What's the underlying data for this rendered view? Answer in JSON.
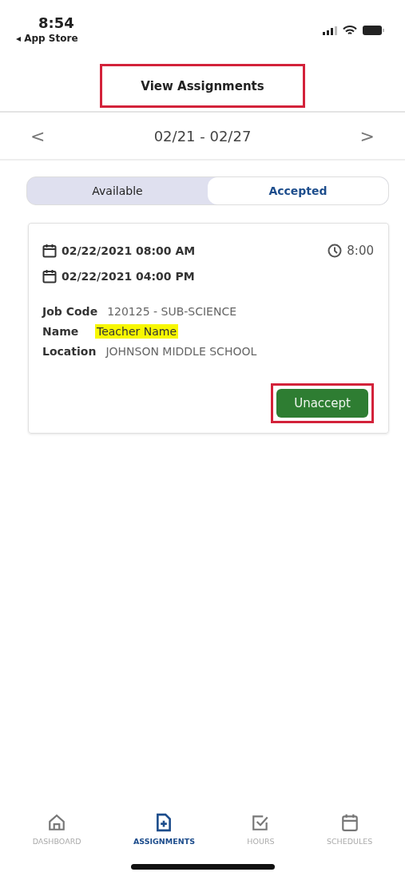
{
  "status_bar": {
    "time": "8:54",
    "back_label": "◂ App Store"
  },
  "header": {
    "title": "View Assignments",
    "annotated": true
  },
  "week_nav": {
    "prev": "<",
    "range": "02/21 - 02/27",
    "next": ">"
  },
  "tabs": [
    {
      "label": "Available",
      "selected": false
    },
    {
      "label": "Accepted",
      "selected": true
    }
  ],
  "assignment": {
    "start": "02/22/2021 08:00 AM",
    "end": "02/22/2021 04:00 PM",
    "duration": "8:00",
    "fields": [
      {
        "label": "Job Code",
        "value": "120125 - SUB-SCIENCE",
        "highlighted": false
      },
      {
        "label": "Name",
        "value": "Teacher Name",
        "highlighted": true
      },
      {
        "label": "Location",
        "value": "JOHNSON MIDDLE SCHOOL",
        "highlighted": false
      }
    ],
    "action": {
      "label": "Unaccept",
      "annotated": true
    }
  },
  "bottom_nav": [
    {
      "kind": "home",
      "label": "DASHBOARD",
      "selected": false
    },
    {
      "kind": "document",
      "label": "ASSIGNMENTS",
      "selected": true
    },
    {
      "kind": "check",
      "label": "HOURS",
      "selected": false
    },
    {
      "kind": "calendar",
      "label": "SCHEDULES",
      "selected": false
    }
  ]
}
